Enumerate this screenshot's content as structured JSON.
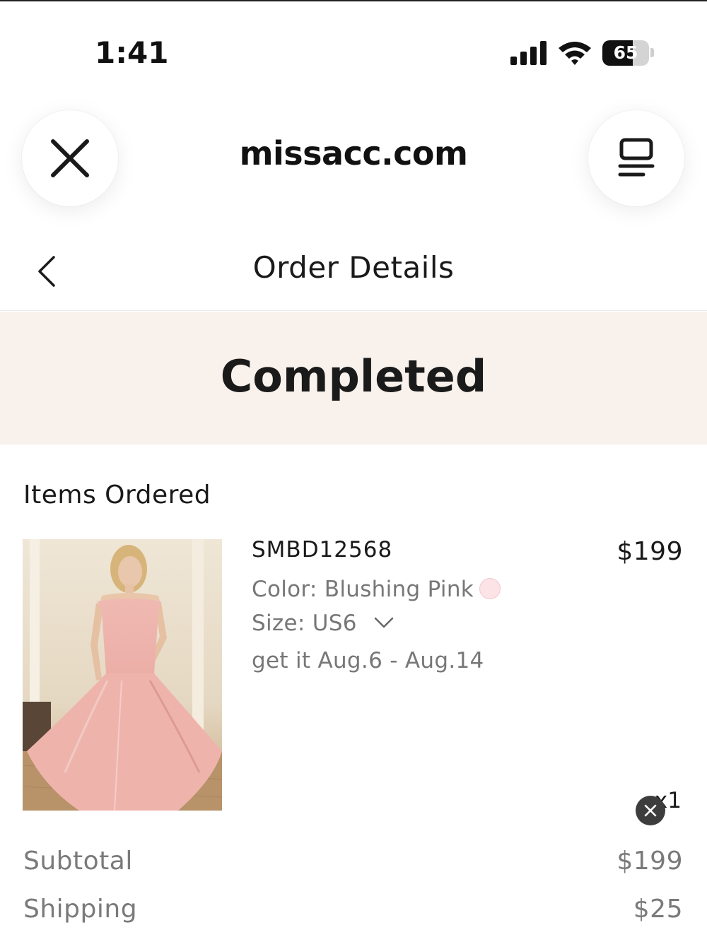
{
  "status_bar": {
    "time": "1:41",
    "battery_percent": 65,
    "battery_label": "65"
  },
  "browser": {
    "url": "missacc.com",
    "close_icon": "close-icon",
    "reader_icon": "reader-mode-icon"
  },
  "header": {
    "title": "Order Details",
    "back_icon": "chevron-left-icon"
  },
  "order": {
    "status": "Completed",
    "status_banner_color": "#f8f1ec"
  },
  "items_section": {
    "title": "Items Ordered",
    "items": [
      {
        "sku": "SMBD12568",
        "price": "$199",
        "color_label": "Color:",
        "color_value": "Blushing Pink",
        "color_swatch": "#fbe3e6",
        "size_label": "Size:",
        "size_value": "US6",
        "delivery": "get it Aug.6 - Aug.14",
        "quantity": "x1"
      }
    ]
  },
  "totals": {
    "subtotal_label": "Subtotal",
    "subtotal_value": "$199",
    "shipping_label": "Shipping",
    "shipping_value": "$25"
  }
}
